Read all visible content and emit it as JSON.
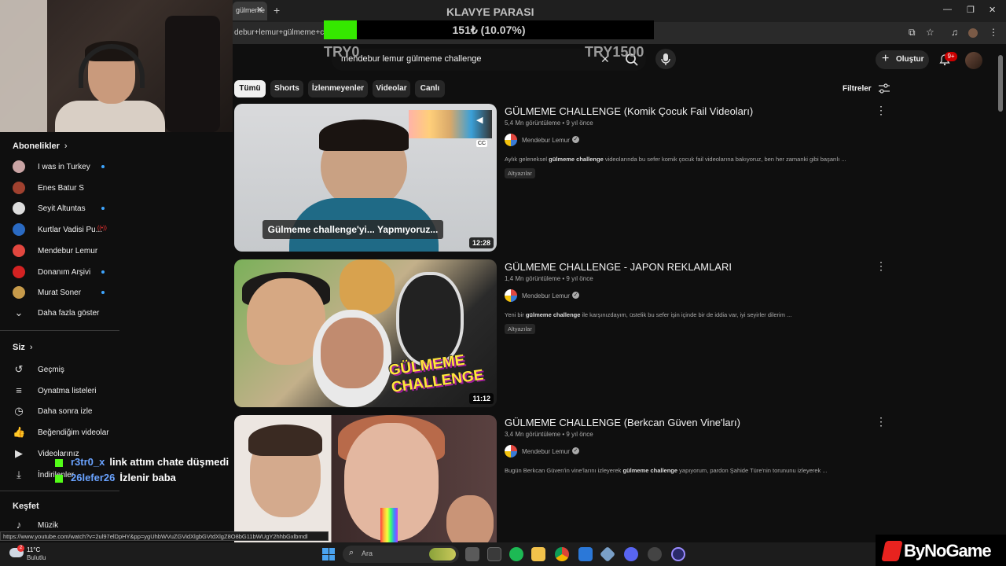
{
  "browser": {
    "tab_label": "gülmeme",
    "tab_close": "✕",
    "new_tab": "+",
    "address_text": "debur+lemur+gülmeme+ch",
    "window_controls": [
      "—",
      "❐",
      "✕"
    ]
  },
  "overlay": {
    "title": "KLAVYE PARASI",
    "progress_text": "151₺ (10.07%)",
    "progress_fraction": 0.1007,
    "min_label": "TRY0",
    "max_label": "TRY1500",
    "accent": "#35e800"
  },
  "youtube": {
    "search_query": "mendebur lemur gülmeme challenge",
    "create_label": "Oluştur",
    "notification_badge": "9+",
    "chips": [
      {
        "label": "Tümü",
        "active": true
      },
      {
        "label": "Shorts",
        "active": false
      },
      {
        "label": "İzlenmeyenler",
        "active": false
      },
      {
        "label": "Videolar",
        "active": false
      },
      {
        "label": "Canlı",
        "active": false
      }
    ],
    "filters_label": "Filtreler"
  },
  "sidebar": {
    "subscriptions_title": "Abonelikler",
    "subscriptions": [
      {
        "label": "I was in Turkey",
        "indicator": "dot",
        "icon_color": "#c9a4a4"
      },
      {
        "label": "Enes Batur S",
        "indicator": "none",
        "icon_color": "#a0412f"
      },
      {
        "label": "Seyit Altuntas",
        "indicator": "dot",
        "icon_color": "#ddd"
      },
      {
        "label": "Kurtlar Vadisi Pu...",
        "indicator": "live",
        "icon_color": "#2a6ac2"
      },
      {
        "label": "Mendebur Lemur",
        "indicator": "none",
        "icon_color": "#e2473f"
      },
      {
        "label": "Donanım Arşivi",
        "indicator": "dot",
        "icon_color": "#d32222"
      },
      {
        "label": "Murat Soner",
        "indicator": "dot",
        "icon_color": "#c69a4a"
      }
    ],
    "show_more": "Daha fazla göster",
    "you_title": "Siz",
    "you_items": [
      {
        "label": "Geçmiş",
        "icon": "history-icon",
        "glyph": "↺"
      },
      {
        "label": "Oynatma listeleri",
        "icon": "playlist-icon",
        "glyph": "≡"
      },
      {
        "label": "Daha sonra izle",
        "icon": "clock-icon",
        "glyph": "◷"
      },
      {
        "label": "Beğendiğim videolar",
        "icon": "thumb-up-icon",
        "glyph": "👍"
      },
      {
        "label": "Videolarınız",
        "icon": "video-icon",
        "glyph": "▶"
      },
      {
        "label": "İndirilenler",
        "icon": "download-icon",
        "glyph": "⤓"
      }
    ],
    "explore_title": "Keşfet",
    "explore_items": [
      {
        "label": "Müzik",
        "icon": "music-icon",
        "glyph": "♪"
      }
    ]
  },
  "chat": [
    {
      "user": "r3tr0_x",
      "message": "link attım chate düşmedi"
    },
    {
      "user": "26lefer26",
      "message": "İzlenir baba"
    }
  ],
  "results": [
    {
      "title": "GÜLMEME CHALLENGE (Komik Çocuk Fail Videoları)",
      "meta": "5,4 Mn görüntüleme • 9 yıl önce",
      "channel": "Mendebur Lemur",
      "desc_before": "Aylık geleneksel ",
      "desc_bold": "gülmeme challenge",
      "desc_after": " videolarında bu sefer komik çocuk fail videolarına bakıyoruz, ben her zamanki gibi başarılı ...",
      "tag": "Altyazılar",
      "duration": "12:28",
      "thumb_caption": "Gülmeme challenge'yi... Yapmıyoruz..."
    },
    {
      "title": "GÜLMEME CHALLENGE - JAPON REKLAMLARI",
      "meta": "1,4 Mn görüntüleme • 9 yıl önce",
      "channel": "Mendebur Lemur",
      "desc_before": "Yeni bir ",
      "desc_bold": "gülmeme challenge",
      "desc_after": " ile karşınızdayım, üstelik bu sefer işin içinde bir de iddia var, iyi seyirler dilerim ...",
      "tag": "Altyazılar",
      "duration": "11:12",
      "thumb_text": "GÜLMEME CHALLENGE"
    },
    {
      "title": "GÜLMEME CHALLENGE (Berkcan Güven Vine'ları)",
      "meta": "3,4 Mn görüntüleme • 9 yıl önce",
      "channel": "Mendebur Lemur",
      "desc_before": "Bugün Berkcan Güven'in vine'larını izleyerek ",
      "desc_bold": "gülmeme challenge",
      "desc_after": " yapıyorum, pardon Şahide Türe'nin torununu izleyerek ..."
    }
  ],
  "status_url": "https://www.youtube.com/watch?v=2ul97elDpHY&pp=ygUhbWVuZGVidXlgbGVtdXlgZ8O8bG11bWUgY2hhbGxlbmdl",
  "taskbar": {
    "temperature": "11°C",
    "weather": "Bulutlu",
    "weather_badge": "2",
    "search_placeholder": "Ara"
  },
  "watermark": {
    "brand": "ByNoGame"
  }
}
